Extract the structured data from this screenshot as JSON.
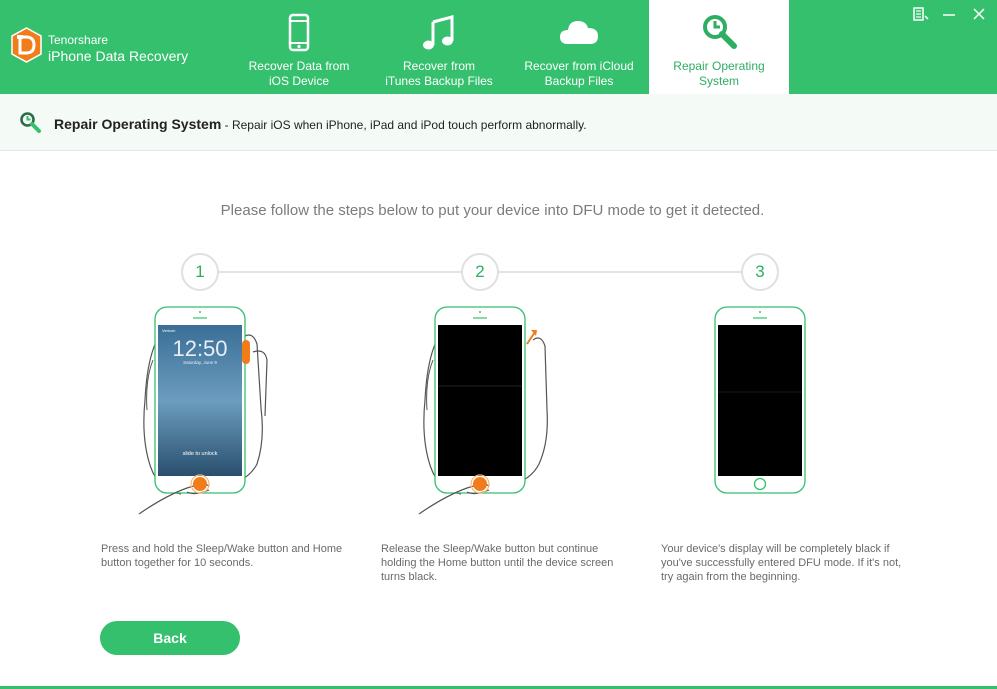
{
  "app": {
    "company": "Tenorshare",
    "product": "iPhone Data Recovery"
  },
  "tabs": [
    {
      "label": "Recover Data from\niOS Device",
      "icon": "phone-icon"
    },
    {
      "label": "Recover from\niTunes Backup Files",
      "icon": "music-note-icon"
    },
    {
      "label": "Recover from iCloud\nBackup Files",
      "icon": "cloud-icon"
    },
    {
      "label": "Repair Operating\nSystem",
      "icon": "wrench-icon",
      "active": true
    }
  ],
  "subheader": {
    "title": "Repair Operating System",
    "description": " - Repair iOS when iPhone, iPad and iPod touch perform abnormally."
  },
  "instruction": "Please follow the steps below to put your device into DFU mode to get it detected.",
  "steps": [
    {
      "number": "1",
      "description": "Press and hold the Sleep/Wake button and Home button together for 10 seconds."
    },
    {
      "number": "2",
      "description": "Release the Sleep/Wake button but continue holding the Home button until the device screen turns black."
    },
    {
      "number": "3",
      "description": "Your device's display will be completely black if you've successfully entered DFU mode. If it's not, try again from the beginning."
    }
  ],
  "lockscreen": {
    "carrier": "Verizon",
    "time": "12:50",
    "date": "Saturday, June 9",
    "unlock": "slide to unlock"
  },
  "back_label": "Back",
  "colors": {
    "accent": "#35c06d",
    "accent_text": "#2fae63",
    "highlight": "#f07d1a"
  }
}
